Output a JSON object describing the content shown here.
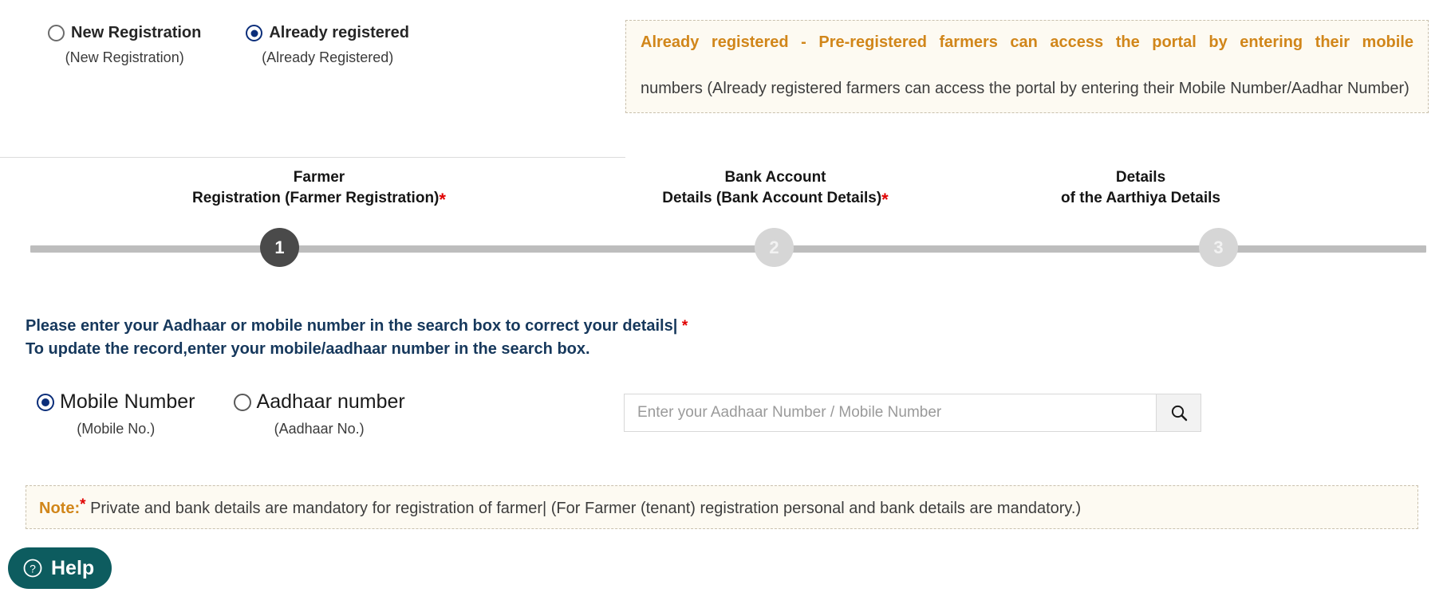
{
  "registration_type": {
    "options": [
      {
        "label": "New Registration",
        "sub": "(New Registration)",
        "selected": false
      },
      {
        "label": "Already registered",
        "sub": "(Already Registered)",
        "selected": true
      }
    ]
  },
  "info_callout": {
    "highlight": "Already registered - Pre-registered farmers can access the portal by entering their mobile",
    "rest": "numbers (Already registered farmers can access the portal by entering their Mobile Number/Aadhar Number)",
    "accent_color": "#d1861a",
    "background_color": "#fdfaf2"
  },
  "stepper": {
    "steps": [
      {
        "number": "1",
        "line1": "Farmer",
        "line2": "Registration (Farmer Registration)",
        "required": "*",
        "state": "active"
      },
      {
        "number": "2",
        "line1": "Bank Account",
        "line2": "Details (Bank Account Details)",
        "required": "*",
        "state": "inactive"
      },
      {
        "number": "3",
        "line1": "Details",
        "line2": "of the Aarthiya Details",
        "required": "",
        "state": "inactive"
      }
    ],
    "active_color": "#4a4a4a",
    "inactive_color": "#d6d6d6",
    "track_color": "#bdbdbd"
  },
  "instructions": {
    "line1": "Please enter your Aadhaar or mobile number in the search box to correct your details|",
    "line1_star": "*",
    "line2": "To update the record,enter your mobile/aadhaar number in the search box.",
    "color": "#16385c"
  },
  "search_section": {
    "options": [
      {
        "label": "Mobile Number",
        "sub": "(Mobile No.)",
        "selected": true
      },
      {
        "label": "Aadhaar number",
        "sub": "(Aadhaar No.)",
        "selected": false
      }
    ],
    "input_value": "",
    "input_placeholder": "Enter your Aadhaar Number / Mobile Number",
    "search_icon": "search-icon"
  },
  "note": {
    "label": "Note:",
    "star": "*",
    "text": "Private and bank details are mandatory for registration of farmer| (For Farmer (tenant) registration personal and bank details are mandatory.)",
    "accent_color": "#d1861a"
  },
  "help": {
    "label": "Help",
    "icon": "question-mark-circle-icon",
    "background_color": "#0d5c5f"
  }
}
